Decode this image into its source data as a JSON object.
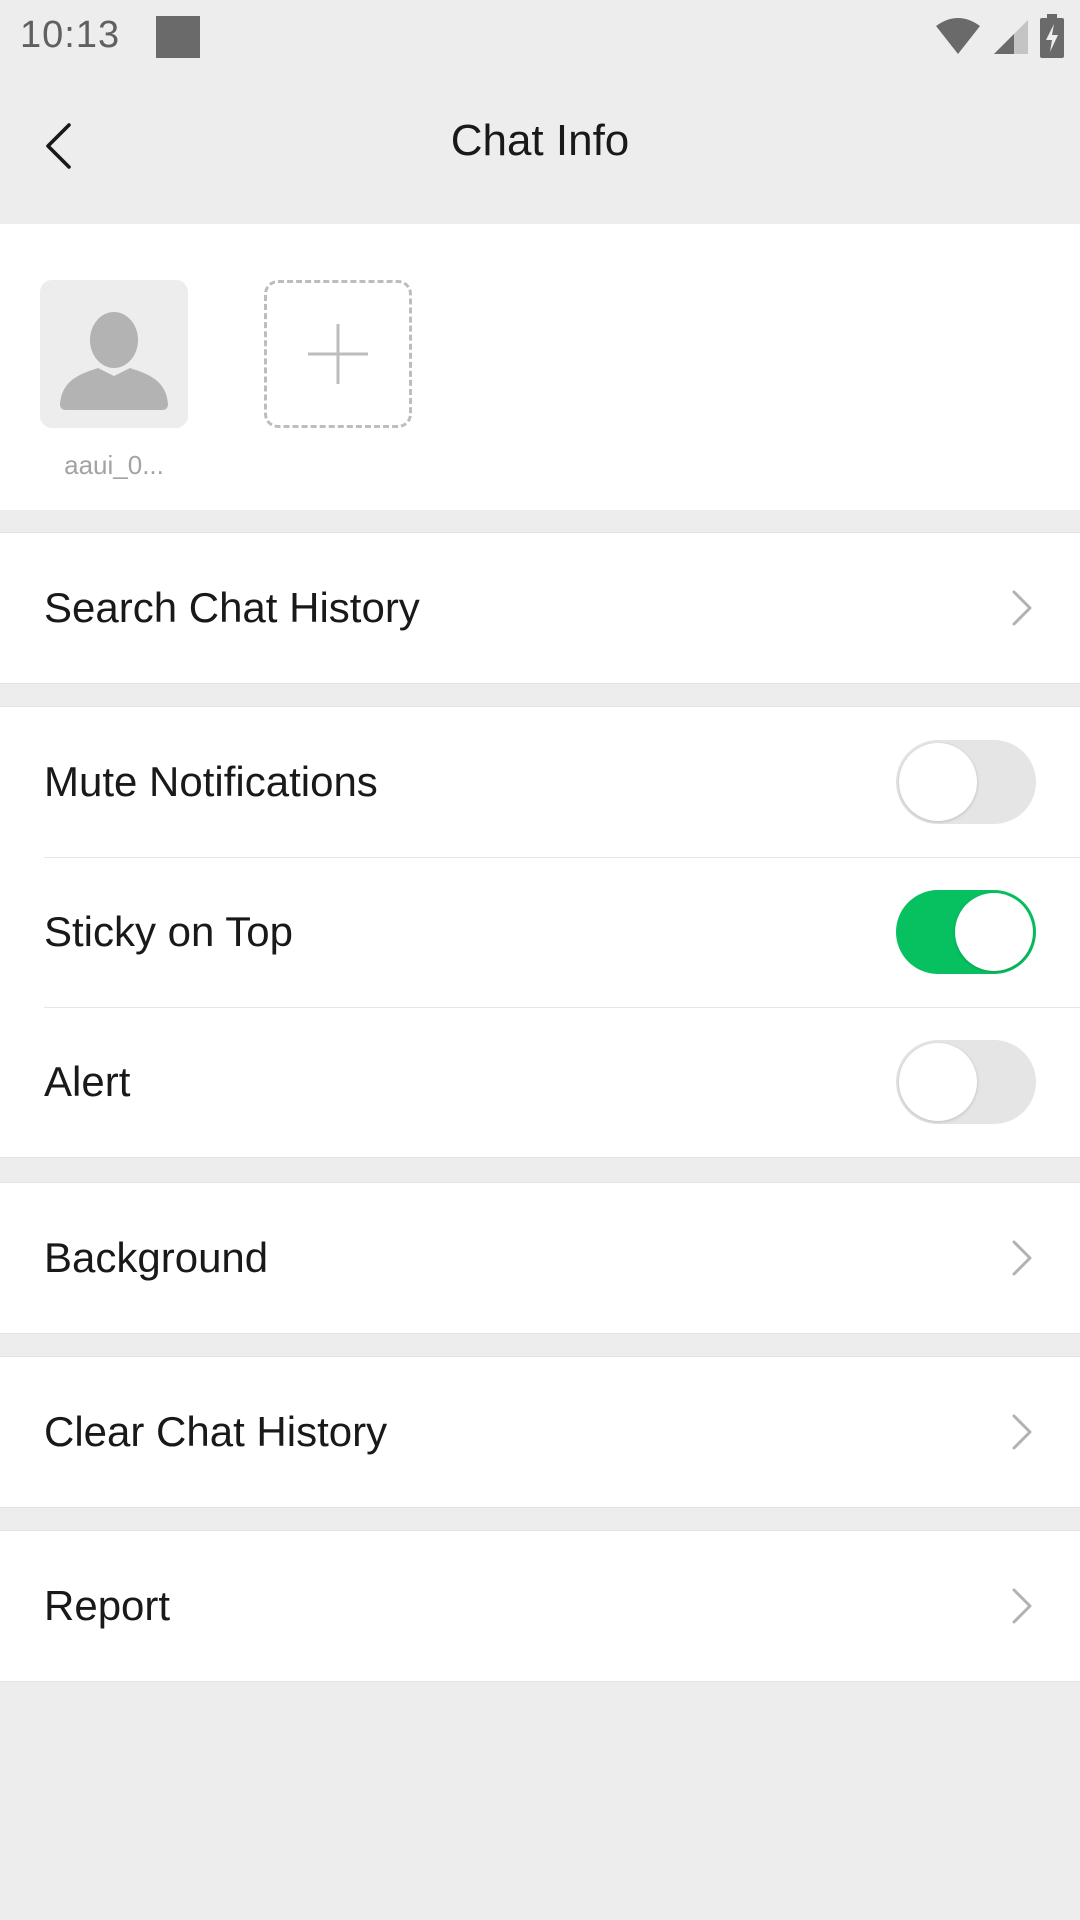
{
  "status_bar": {
    "time": "10:13",
    "icons": [
      "notification-square-icon",
      "wifi-icon",
      "signal-icon",
      "battery-charging-icon"
    ]
  },
  "header": {
    "title": "Chat Info",
    "back_icon": "back-chevron-icon"
  },
  "members": {
    "items": [
      {
        "name": "aaui_0...",
        "avatar_icon": "default-avatar-icon"
      }
    ],
    "add_icon": "plus-icon"
  },
  "groups": [
    {
      "cells": [
        {
          "label": "Search Chat History",
          "type": "link",
          "icon": "chevron-right-icon"
        }
      ]
    },
    {
      "cells": [
        {
          "label": "Mute Notifications",
          "type": "switch",
          "on": false
        },
        {
          "label": "Sticky on Top",
          "type": "switch",
          "on": true
        },
        {
          "label": "Alert",
          "type": "switch",
          "on": false
        }
      ]
    },
    {
      "cells": [
        {
          "label": "Background",
          "type": "link",
          "icon": "chevron-right-icon"
        }
      ]
    },
    {
      "cells": [
        {
          "label": "Clear Chat History",
          "type": "link",
          "icon": "chevron-right-icon"
        }
      ]
    },
    {
      "cells": [
        {
          "label": "Report",
          "type": "link",
          "icon": "chevron-right-icon"
        }
      ]
    }
  ],
  "colors": {
    "background": "#ededed",
    "switch_on": "#07c160",
    "switch_off": "#e5e5e5",
    "text": "#191919",
    "secondary_text": "#a3a3a3"
  }
}
